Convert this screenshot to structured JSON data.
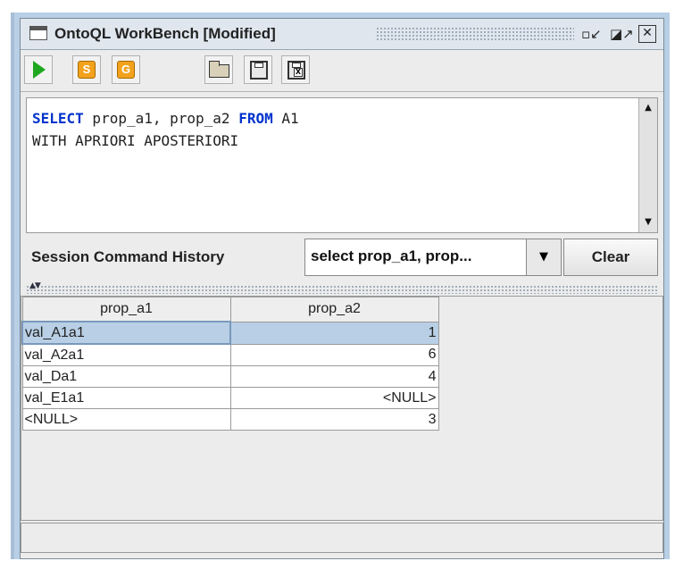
{
  "window": {
    "title": "OntoQL WorkBench [Modified]",
    "controls": {
      "minimize": "▫↙",
      "maximize": "◪↗",
      "close": "✕"
    }
  },
  "toolbar": {
    "run": {
      "icon": "play-icon"
    },
    "s_badge": "S",
    "g_badge": "G",
    "open": {
      "icon": "folder-open-icon"
    },
    "save": {
      "icon": "save-disk-icon"
    },
    "export": {
      "icon": "export-disk-icon",
      "badge": "X"
    }
  },
  "editor": {
    "line1": {
      "kw1": "SELECT",
      "mid": " prop_a1, prop_a2 ",
      "kw2": "FROM",
      "tail": " A1"
    },
    "line2": "WITH APRIORI APOSTERIORI"
  },
  "history": {
    "label": "Session Command History",
    "selected": "select prop_a1, prop...",
    "clear_label": "Clear"
  },
  "results": {
    "columns": [
      "prop_a1",
      "prop_a2"
    ],
    "rows": [
      [
        "val_A1a1",
        "1"
      ],
      [
        "val_A2a1",
        "6"
      ],
      [
        "val_Da1",
        "4"
      ],
      [
        "val_E1a1",
        "<NULL>"
      ],
      [
        "<NULL>",
        "3"
      ]
    ]
  },
  "colors": {
    "keyword": "#0033cc",
    "selection": "#b8cfe5",
    "run": "#1fa81f",
    "badge": "#f2a21c"
  }
}
